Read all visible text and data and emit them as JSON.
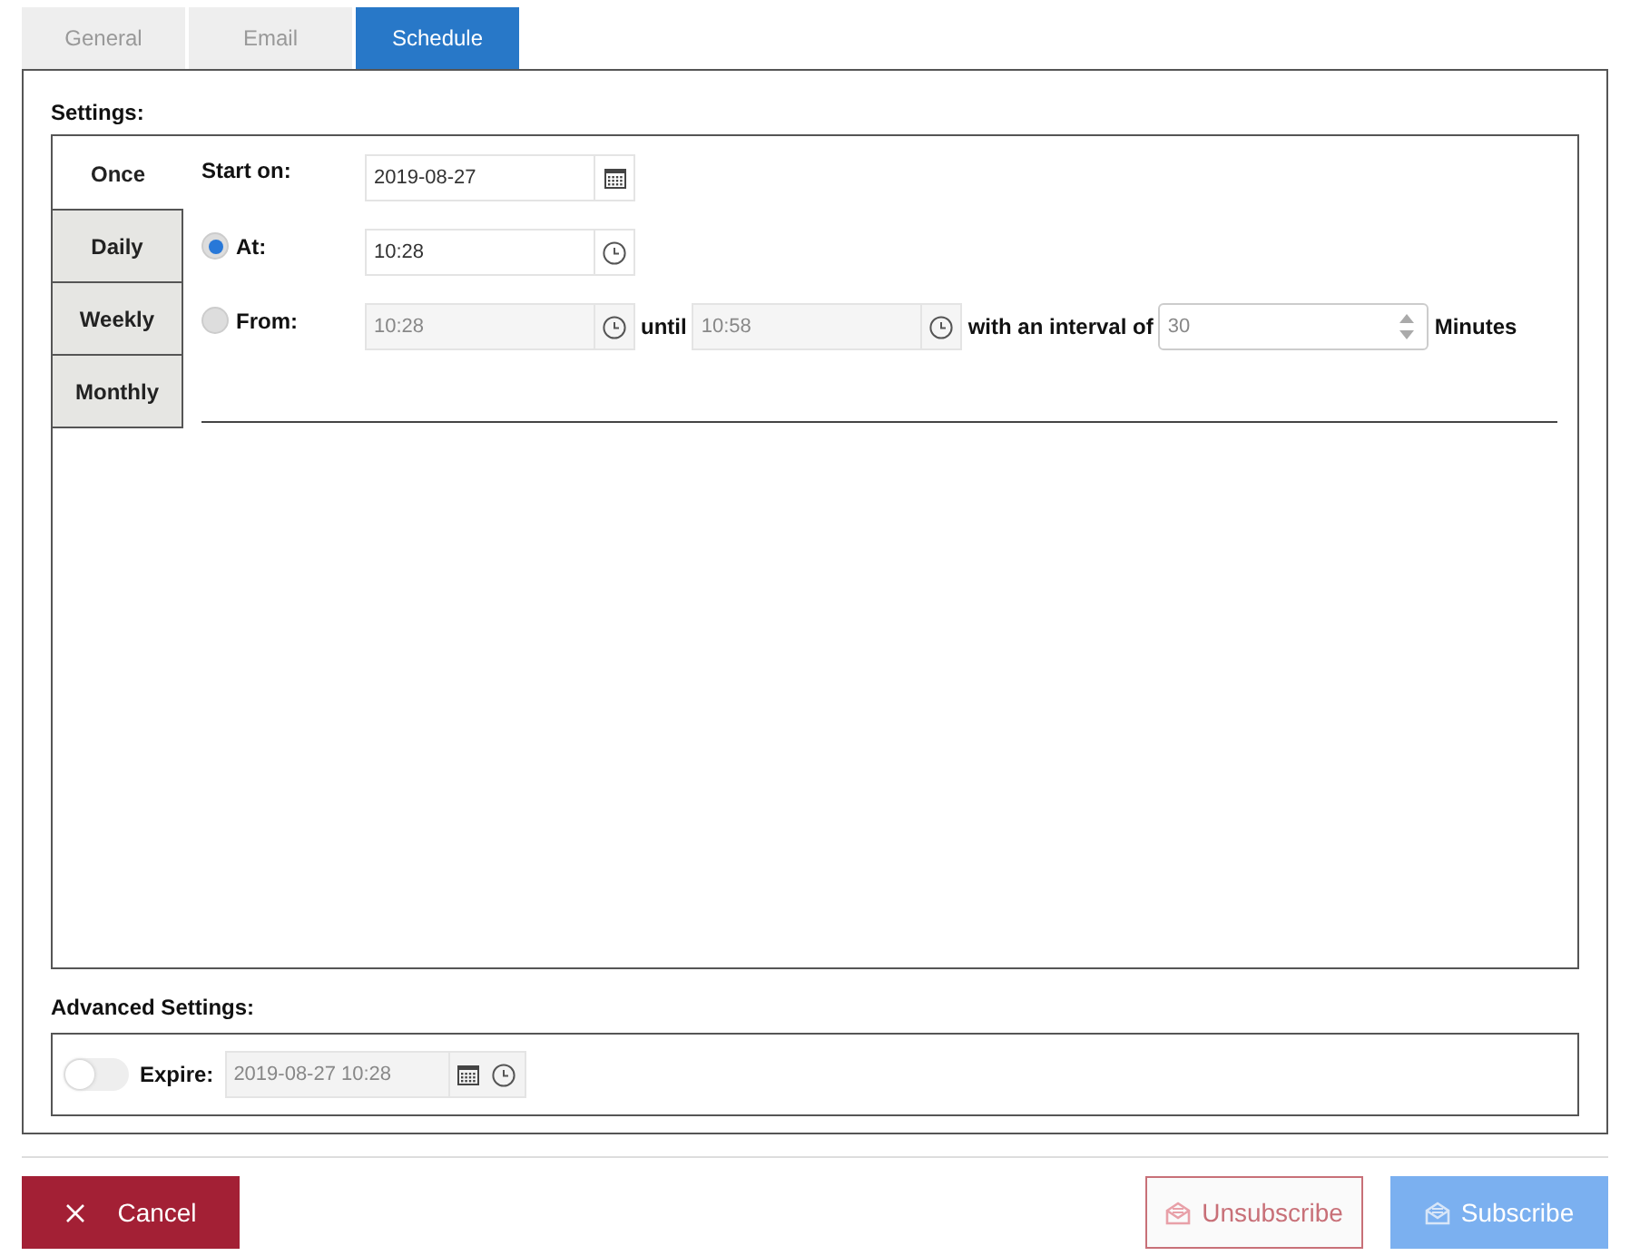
{
  "tabs": [
    {
      "label": "General",
      "selected": false
    },
    {
      "label": "Email",
      "selected": false
    },
    {
      "label": "Schedule",
      "selected": true
    }
  ],
  "settings": {
    "title": "Settings:",
    "modes": [
      {
        "label": "Once",
        "selected": true
      },
      {
        "label": "Daily",
        "selected": false
      },
      {
        "label": "Weekly",
        "selected": false
      },
      {
        "label": "Monthly",
        "selected": false
      }
    ],
    "start": {
      "label": "Start on:",
      "value": "2019-08-27",
      "disabled": false
    },
    "at": {
      "label": "At:",
      "selected": true,
      "value": "10:28",
      "disabled": false
    },
    "from": {
      "label": "From:",
      "selected": false,
      "value": "10:28",
      "disabled": true,
      "until_label": "until",
      "until_value": "10:58",
      "interval_label": "with an interval of",
      "interval_value": "30",
      "unit": "Minutes"
    }
  },
  "advanced": {
    "title": "Advanced Settings:",
    "expire_label": "Expire:",
    "expire_on": false,
    "expire_value": "2019-08-27 10:28"
  },
  "buttons": [
    {
      "kind": "cancel",
      "label": "Cancel",
      "disabled": false
    },
    {
      "kind": "unsubscribe",
      "label": "Unsubscribe",
      "disabled": true
    },
    {
      "kind": "subscribe",
      "label": "Subscribe",
      "disabled": true
    }
  ]
}
